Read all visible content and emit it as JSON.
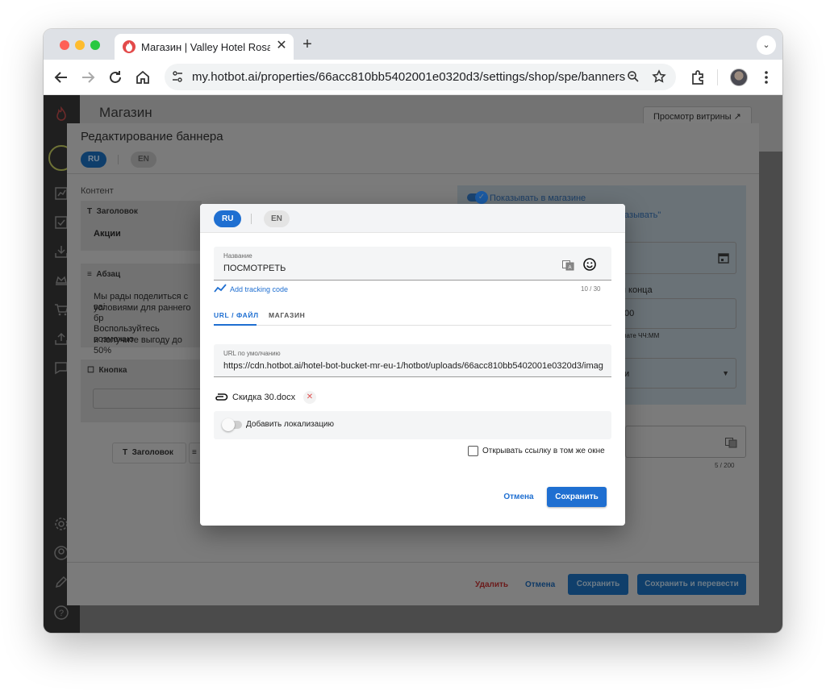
{
  "browser": {
    "tab_title": "Магазин | Valley Hotel Rosa Khutor",
    "url": "my.hotbot.ai/properties/66acc810bb5402001e0320d3/settings/shop/spe/banners"
  },
  "page": {
    "title": "Магазин",
    "preview_button": "Просмотр витрины ↗"
  },
  "edit_modal": {
    "title": "Редактирование баннера",
    "langs": [
      "RU",
      "EN"
    ],
    "content_label": "Контент",
    "heading_card": {
      "title": "Заголовок",
      "value": "Акции"
    },
    "paragraph_card": {
      "title": "Абзац",
      "line1": "Мы рады поделиться с ваі",
      "line2": "условиями для раннего бр",
      "line3": "Воспользуйтесь возможно",
      "line4": "и получите выгоду до 50%"
    },
    "button_card": {
      "title": "Кнопка"
    },
    "add_heading_button": "Заголовок",
    "show_in_shop": "Показывать в магазине",
    "show_label_partial": "казывать\"",
    "end_label_partial": "я конца",
    "time_partial": "00",
    "format_hint": "мате ЧЧ:ММ",
    "select_partial": "и",
    "counter": "5 / 200",
    "footer": {
      "delete": "Удалить",
      "cancel": "Отмена",
      "save": "Сохранить",
      "save_translate": "Сохранить и перевести"
    }
  },
  "dialog": {
    "langs": {
      "active": "RU",
      "other": "EN"
    },
    "name_field": {
      "label": "Название",
      "value": "ПОСМОТРЕТЬ",
      "counter": "10 / 30"
    },
    "tracking_link": "Add tracking code",
    "tabs": [
      "URL / ФАЙЛ",
      "МАГАЗИН"
    ],
    "url_field": {
      "label": "URL по умолчанию",
      "value": "https://cdn.hotbot.ai/hotel-bot-bucket-mr-eu-1/hotbot/uploads/66acc810bb5402001e0320d3/imag"
    },
    "file_name": "Скидка 30.docx",
    "localization_toggle": "Добавить локализацию",
    "same_window_checkbox": "Открывать ссылку в том же окне",
    "cancel_button": "Отмена",
    "save_button": "Сохранить"
  },
  "colors": {
    "accent": "#1f6fd1",
    "danger": "#e05050"
  }
}
